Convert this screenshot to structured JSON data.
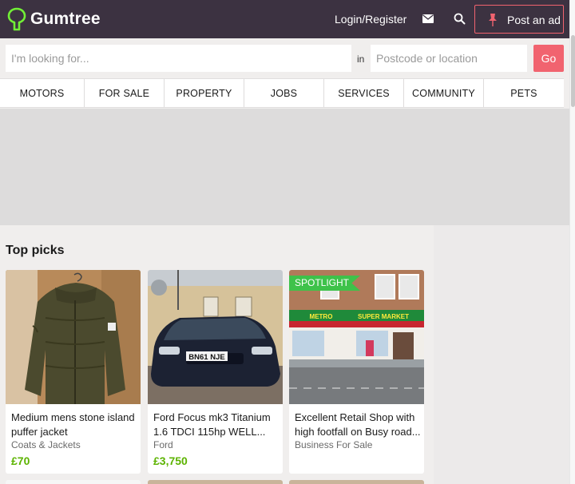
{
  "header": {
    "brand": "Gumtree",
    "login_label": "Login/Register",
    "post_ad_label": "Post an ad",
    "icons": [
      "gumtree-tree-logo",
      "mail-icon",
      "search-icon",
      "pin-icon"
    ],
    "colors": {
      "bg": "#3c3241",
      "accent": "#f1636f",
      "brand_green": "#5cb300"
    }
  },
  "search": {
    "keyword_placeholder": "I'm looking for...",
    "in_label": "in",
    "location_placeholder": "Postcode or location",
    "go_label": "Go"
  },
  "categories": [
    "MOTORS",
    "FOR SALE",
    "PROPERTY",
    "JOBS",
    "SERVICES",
    "COMMUNITY",
    "PETS"
  ],
  "top_picks": {
    "heading": "Top picks",
    "items": [
      {
        "title": "Medium mens stone island puffer jacket",
        "category": "Coats & Jackets",
        "price": "£70",
        "badge": ""
      },
      {
        "title": "Ford Focus mk3 Titanium 1.6 TDCI 115hp WELL...",
        "category": "Ford",
        "price": "£3,750",
        "badge": ""
      },
      {
        "title": "Excellent Retail Shop with high footfall on Busy road...",
        "category": "Business For Sale",
        "price": "",
        "badge": "SPOTLIGHT"
      }
    ]
  },
  "images": {
    "car_plate": "BN61 NJE",
    "shop_sign_left": "METRO",
    "shop_sign_right": "SUPER MARKET"
  }
}
